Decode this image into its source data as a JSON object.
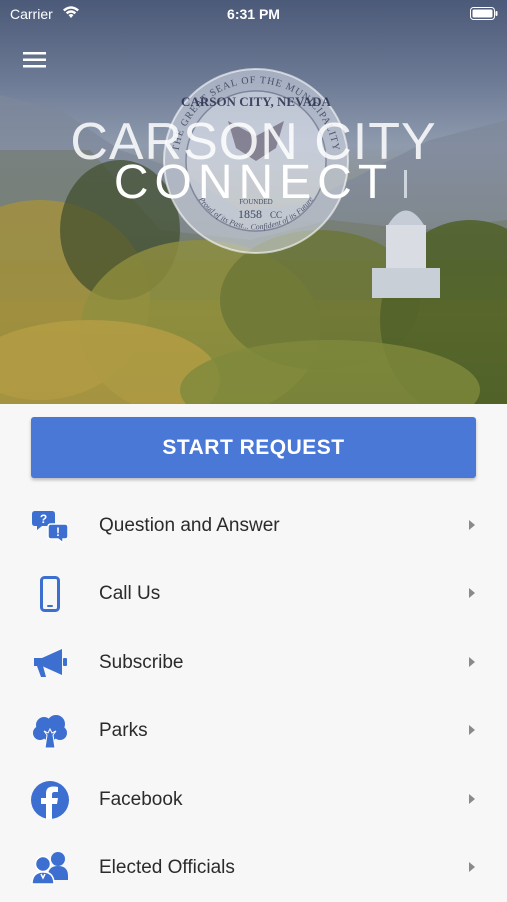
{
  "status_bar": {
    "carrier": "Carrier",
    "time": "6:31 PM"
  },
  "hero": {
    "title_line1": "CARSON CITY",
    "title_line2": "CONNECT",
    "seal": {
      "top_text": "THE GREAT SEAL OF THE MUNICIPALITY",
      "city": "CARSON CITY, NEVADA",
      "founded": "FOUNDED",
      "year": "1858",
      "cc": "CC",
      "motto": "Proud of its Past... Confident of its Future"
    }
  },
  "start_request": {
    "label": "START REQUEST"
  },
  "menu": [
    {
      "label": "Question and Answer",
      "icon": "question-answer-icon"
    },
    {
      "label": "Call Us",
      "icon": "phone-icon"
    },
    {
      "label": "Subscribe",
      "icon": "megaphone-icon"
    },
    {
      "label": "Parks",
      "icon": "tree-icon"
    },
    {
      "label": "Facebook",
      "icon": "facebook-icon"
    },
    {
      "label": "Elected Officials",
      "icon": "people-icon"
    }
  ],
  "colors": {
    "accent": "#4a78d6",
    "text": "#2b2b2b",
    "chevron": "#8a8a8a"
  }
}
